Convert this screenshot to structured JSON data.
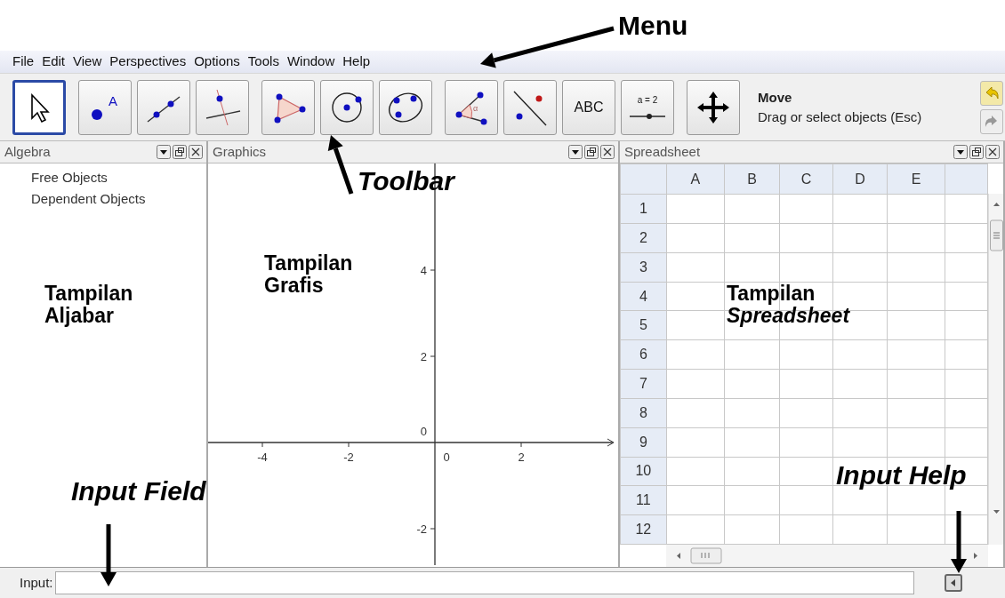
{
  "menu": [
    "File",
    "Edit",
    "View",
    "Perspectives",
    "Options",
    "Tools",
    "Window",
    "Help"
  ],
  "toolbar": {
    "tool_groups": [
      [
        {
          "kind": "move",
          "selected": true
        }
      ],
      [
        {
          "kind": "point",
          "selected": false,
          "icon_text": "A"
        },
        {
          "kind": "line",
          "selected": false
        },
        {
          "kind": "perpendicular",
          "selected": false
        }
      ],
      [
        {
          "kind": "polygon",
          "selected": false
        },
        {
          "kind": "circle",
          "selected": false
        },
        {
          "kind": "conic",
          "selected": false
        }
      ],
      [
        {
          "kind": "angle",
          "selected": false,
          "icon_text": "α"
        },
        {
          "kind": "reflect",
          "selected": false
        },
        {
          "kind": "text",
          "selected": false,
          "icon_text": "ABC"
        },
        {
          "kind": "slider",
          "selected": false,
          "icon_text": "a = 2"
        }
      ],
      [
        {
          "kind": "move_view",
          "selected": false
        }
      ]
    ],
    "tool_name": "Move",
    "tool_help": "Drag or select objects (Esc)"
  },
  "algebra": {
    "title": "Algebra",
    "items": [
      "Free Objects",
      "Dependent Objects"
    ]
  },
  "graphics": {
    "title": "Graphics",
    "x_tick_labels": [
      "-4",
      "-2",
      "0",
      "2"
    ],
    "y_tick_labels": [
      "4",
      "2",
      "0",
      "-2"
    ]
  },
  "spreadsheet": {
    "title": "Spreadsheet",
    "columns": [
      "A",
      "B",
      "C",
      "D",
      "E"
    ],
    "rows": [
      "1",
      "2",
      "3",
      "4",
      "5",
      "6",
      "7",
      "8",
      "9",
      "10",
      "11",
      "12"
    ]
  },
  "input_bar": {
    "label": "Input:"
  },
  "annotations": [
    {
      "kind": "callout",
      "text": "Menu",
      "italic": false
    },
    {
      "kind": "callout",
      "text": "Toolbar",
      "italic": true
    },
    {
      "kind": "view_label",
      "text": "Tampilan\nGrafis",
      "italic": false
    },
    {
      "kind": "view_label",
      "text": "Tampilan\nAljabar",
      "italic": false
    },
    {
      "kind": "view_label",
      "text": "Tampilan\n*Spreadsheet*",
      "italic": false
    },
    {
      "kind": "callout",
      "text": "Input Field",
      "italic": true
    },
    {
      "kind": "callout",
      "text": "Input Help",
      "italic": true
    }
  ]
}
